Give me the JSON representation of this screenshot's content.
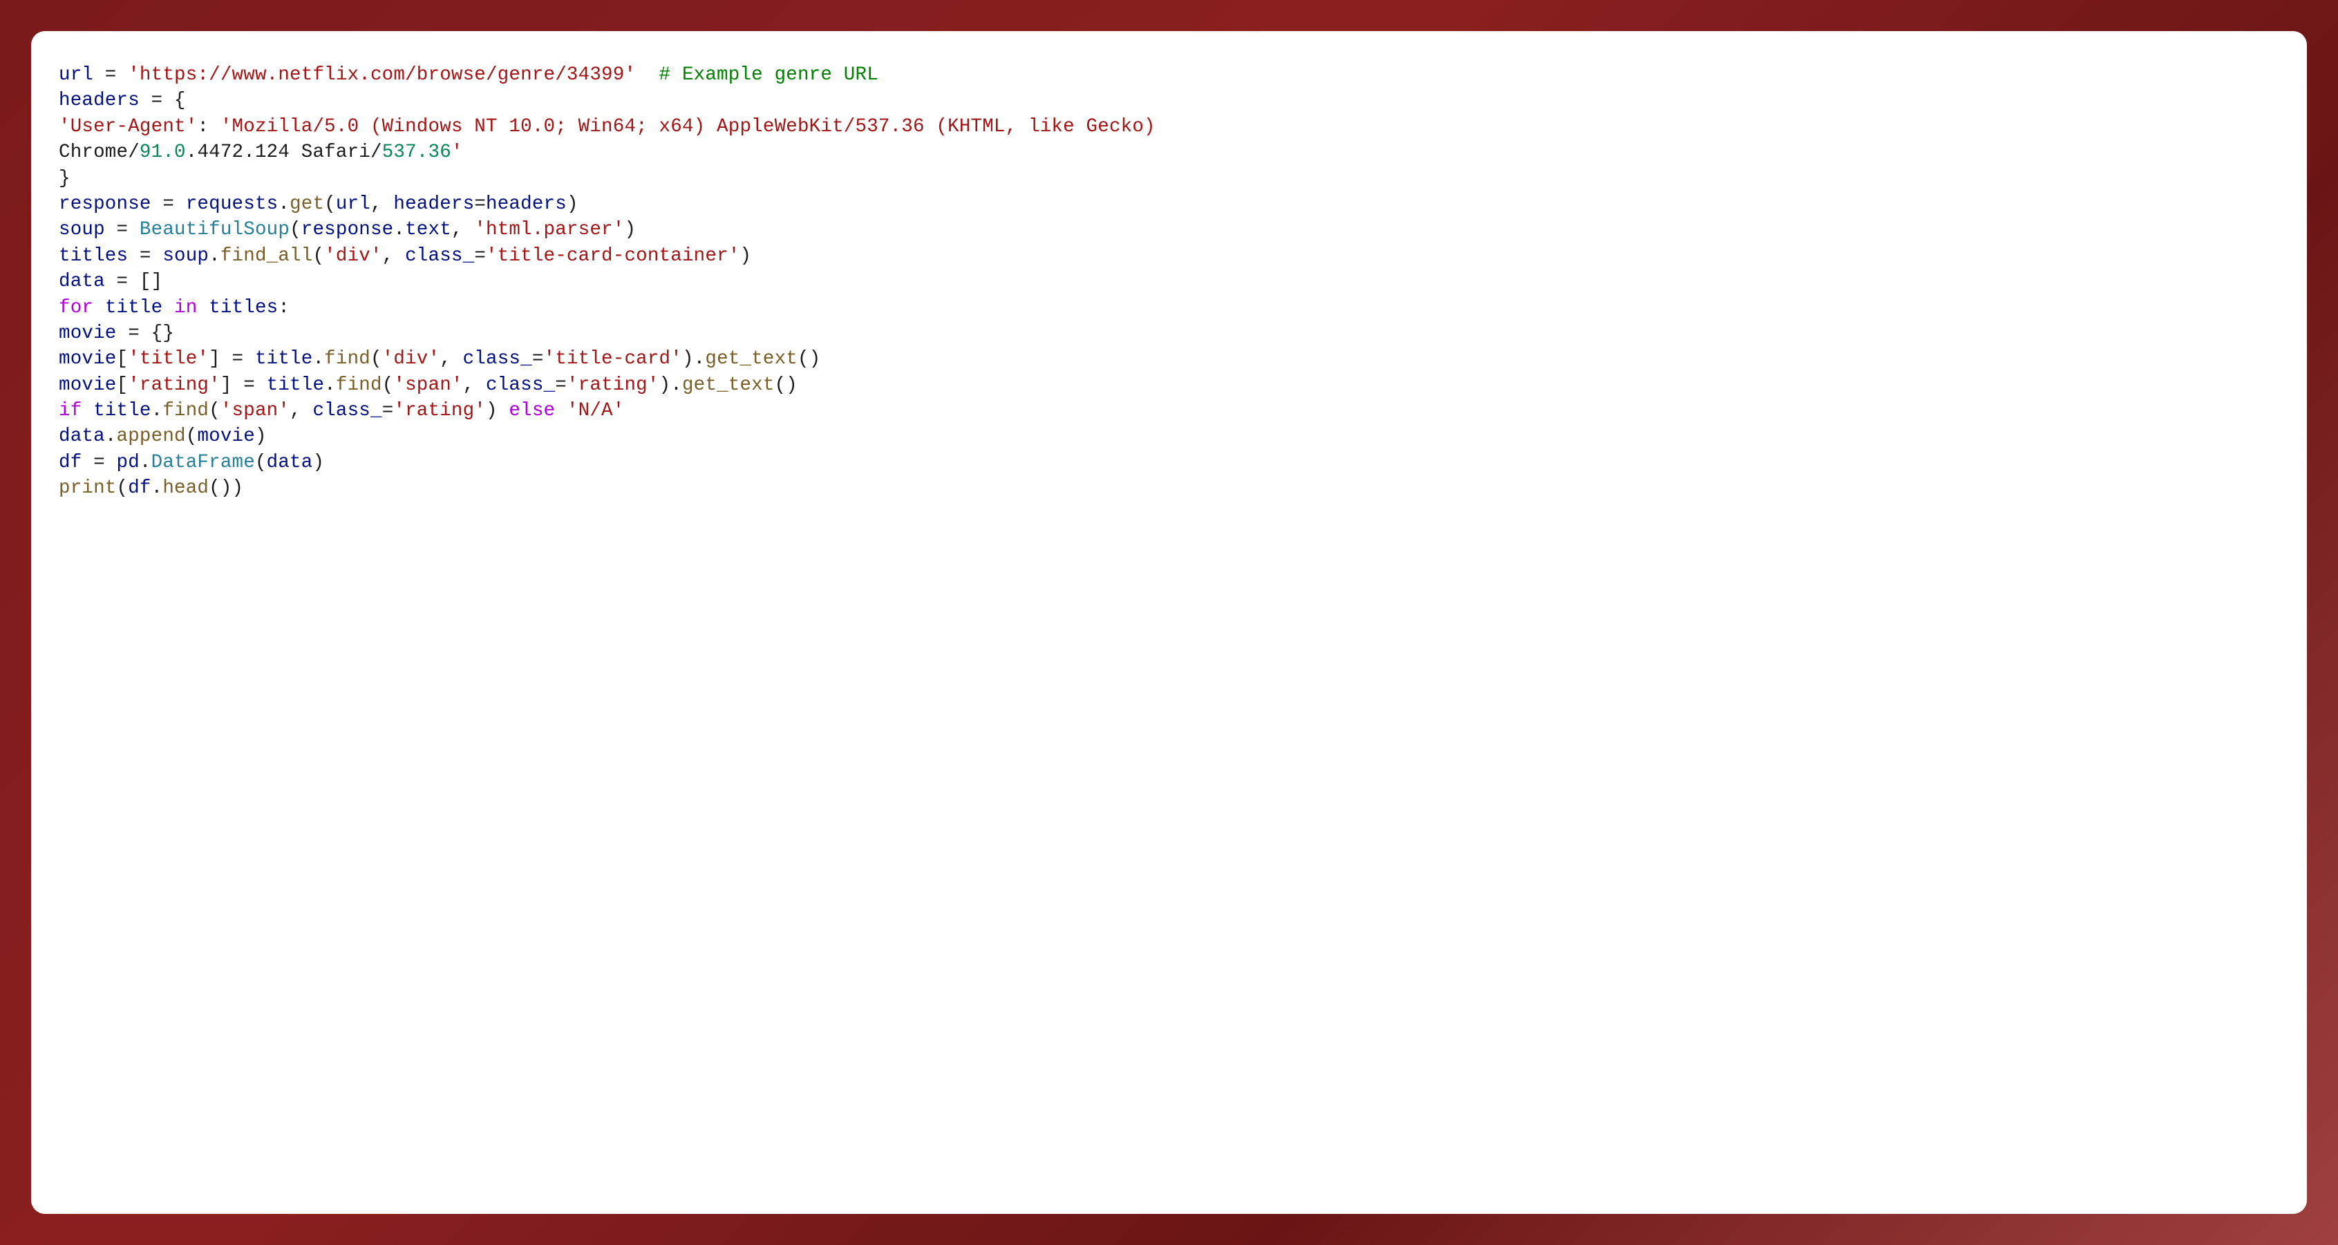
{
  "code": {
    "lines": [
      {
        "tokens": [
          {
            "text": "url",
            "class": "token-variable"
          },
          {
            "text": " = ",
            "class": "token-operator"
          },
          {
            "text": "'https://www.netflix.com/browse/genre/34399'",
            "class": "token-string"
          },
          {
            "text": "  ",
            "class": ""
          },
          {
            "text": "# Example genre URL",
            "class": "token-comment"
          }
        ]
      },
      {
        "tokens": [
          {
            "text": "headers",
            "class": "token-variable"
          },
          {
            "text": " = {",
            "class": "token-operator"
          }
        ]
      },
      {
        "tokens": [
          {
            "text": "'User-Agent'",
            "class": "token-string"
          },
          {
            "text": ": ",
            "class": "token-punct"
          },
          {
            "text": "'Mozilla/5.0 (Windows NT 10.0; Win64; x64) AppleWebKit/537.36 (KHTML, like Gecko) ",
            "class": "token-string"
          }
        ]
      },
      {
        "tokens": [
          {
            "text": "Chrome/",
            "class": ""
          },
          {
            "text": "91.0",
            "class": "token-number"
          },
          {
            "text": ".",
            "class": ""
          },
          {
            "text": "4472.124",
            "class": ""
          },
          {
            "text": " Safari/",
            "class": ""
          },
          {
            "text": "537.36",
            "class": "token-number"
          },
          {
            "text": "'",
            "class": "token-string"
          }
        ]
      },
      {
        "tokens": [
          {
            "text": "}",
            "class": "token-punct"
          }
        ]
      },
      {
        "tokens": [
          {
            "text": "response",
            "class": "token-variable"
          },
          {
            "text": " = ",
            "class": "token-operator"
          },
          {
            "text": "requests",
            "class": "token-variable"
          },
          {
            "text": ".",
            "class": "token-punct"
          },
          {
            "text": "get",
            "class": "token-function"
          },
          {
            "text": "(",
            "class": "token-punct"
          },
          {
            "text": "url",
            "class": "token-variable"
          },
          {
            "text": ", ",
            "class": "token-punct"
          },
          {
            "text": "headers",
            "class": "token-variable"
          },
          {
            "text": "=",
            "class": "token-operator"
          },
          {
            "text": "headers",
            "class": "token-variable"
          },
          {
            "text": ")",
            "class": "token-punct"
          }
        ]
      },
      {
        "tokens": [
          {
            "text": "soup",
            "class": "token-variable"
          },
          {
            "text": " = ",
            "class": "token-operator"
          },
          {
            "text": "BeautifulSoup",
            "class": "token-classname"
          },
          {
            "text": "(",
            "class": "token-punct"
          },
          {
            "text": "response",
            "class": "token-variable"
          },
          {
            "text": ".",
            "class": "token-punct"
          },
          {
            "text": "text",
            "class": "token-property"
          },
          {
            "text": ", ",
            "class": "token-punct"
          },
          {
            "text": "'html.parser'",
            "class": "token-string"
          },
          {
            "text": ")",
            "class": "token-punct"
          }
        ]
      },
      {
        "tokens": [
          {
            "text": "titles",
            "class": "token-variable"
          },
          {
            "text": " = ",
            "class": "token-operator"
          },
          {
            "text": "soup",
            "class": "token-variable"
          },
          {
            "text": ".",
            "class": "token-punct"
          },
          {
            "text": "find_all",
            "class": "token-function"
          },
          {
            "text": "(",
            "class": "token-punct"
          },
          {
            "text": "'div'",
            "class": "token-string"
          },
          {
            "text": ", ",
            "class": "token-punct"
          },
          {
            "text": "class_",
            "class": "token-variable"
          },
          {
            "text": "=",
            "class": "token-operator"
          },
          {
            "text": "'title-card-container'",
            "class": "token-string"
          },
          {
            "text": ")",
            "class": "token-punct"
          }
        ]
      },
      {
        "tokens": [
          {
            "text": "data",
            "class": "token-variable"
          },
          {
            "text": " = []",
            "class": "token-operator"
          }
        ]
      },
      {
        "tokens": [
          {
            "text": "for",
            "class": "token-keyword-purple"
          },
          {
            "text": " ",
            "class": ""
          },
          {
            "text": "title",
            "class": "token-variable"
          },
          {
            "text": " ",
            "class": ""
          },
          {
            "text": "in",
            "class": "token-keyword-purple"
          },
          {
            "text": " ",
            "class": ""
          },
          {
            "text": "titles",
            "class": "token-variable"
          },
          {
            "text": ":",
            "class": "token-punct"
          }
        ]
      },
      {
        "tokens": [
          {
            "text": "movie",
            "class": "token-variable"
          },
          {
            "text": " = {}",
            "class": "token-operator"
          }
        ]
      },
      {
        "tokens": [
          {
            "text": "movie",
            "class": "token-variable"
          },
          {
            "text": "[",
            "class": "token-punct"
          },
          {
            "text": "'title'",
            "class": "token-string"
          },
          {
            "text": "] = ",
            "class": "token-operator"
          },
          {
            "text": "title",
            "class": "token-variable"
          },
          {
            "text": ".",
            "class": "token-punct"
          },
          {
            "text": "find",
            "class": "token-function"
          },
          {
            "text": "(",
            "class": "token-punct"
          },
          {
            "text": "'div'",
            "class": "token-string"
          },
          {
            "text": ", ",
            "class": "token-punct"
          },
          {
            "text": "class_",
            "class": "token-variable"
          },
          {
            "text": "=",
            "class": "token-operator"
          },
          {
            "text": "'title-card'",
            "class": "token-string"
          },
          {
            "text": ").",
            "class": "token-punct"
          },
          {
            "text": "get_text",
            "class": "token-function"
          },
          {
            "text": "()",
            "class": "token-punct"
          }
        ]
      },
      {
        "tokens": [
          {
            "text": "movie",
            "class": "token-variable"
          },
          {
            "text": "[",
            "class": "token-punct"
          },
          {
            "text": "'rating'",
            "class": "token-string"
          },
          {
            "text": "] = ",
            "class": "token-operator"
          },
          {
            "text": "title",
            "class": "token-variable"
          },
          {
            "text": ".",
            "class": "token-punct"
          },
          {
            "text": "find",
            "class": "token-function"
          },
          {
            "text": "(",
            "class": "token-punct"
          },
          {
            "text": "'span'",
            "class": "token-string"
          },
          {
            "text": ", ",
            "class": "token-punct"
          },
          {
            "text": "class_",
            "class": "token-variable"
          },
          {
            "text": "=",
            "class": "token-operator"
          },
          {
            "text": "'rating'",
            "class": "token-string"
          },
          {
            "text": ").",
            "class": "token-punct"
          },
          {
            "text": "get_text",
            "class": "token-function"
          },
          {
            "text": "()",
            "class": "token-punct"
          }
        ]
      },
      {
        "tokens": [
          {
            "text": "if",
            "class": "token-keyword-purple"
          },
          {
            "text": " ",
            "class": ""
          },
          {
            "text": "title",
            "class": "token-variable"
          },
          {
            "text": ".",
            "class": "token-punct"
          },
          {
            "text": "find",
            "class": "token-function"
          },
          {
            "text": "(",
            "class": "token-punct"
          },
          {
            "text": "'span'",
            "class": "token-string"
          },
          {
            "text": ", ",
            "class": "token-punct"
          },
          {
            "text": "class_",
            "class": "token-variable"
          },
          {
            "text": "=",
            "class": "token-operator"
          },
          {
            "text": "'rating'",
            "class": "token-string"
          },
          {
            "text": ") ",
            "class": "token-punct"
          },
          {
            "text": "else",
            "class": "token-keyword-purple"
          },
          {
            "text": " ",
            "class": ""
          },
          {
            "text": "'N/A'",
            "class": "token-string"
          }
        ]
      },
      {
        "tokens": [
          {
            "text": "data",
            "class": "token-variable"
          },
          {
            "text": ".",
            "class": "token-punct"
          },
          {
            "text": "append",
            "class": "token-function"
          },
          {
            "text": "(",
            "class": "token-punct"
          },
          {
            "text": "movie",
            "class": "token-variable"
          },
          {
            "text": ")",
            "class": "token-punct"
          }
        ]
      },
      {
        "tokens": [
          {
            "text": "df",
            "class": "token-variable"
          },
          {
            "text": " = ",
            "class": "token-operator"
          },
          {
            "text": "pd",
            "class": "token-variable"
          },
          {
            "text": ".",
            "class": "token-punct"
          },
          {
            "text": "DataFrame",
            "class": "token-classname"
          },
          {
            "text": "(",
            "class": "token-punct"
          },
          {
            "text": "data",
            "class": "token-variable"
          },
          {
            "text": ")",
            "class": "token-punct"
          }
        ]
      },
      {
        "tokens": [
          {
            "text": "print",
            "class": "token-function"
          },
          {
            "text": "(",
            "class": "token-punct"
          },
          {
            "text": "df",
            "class": "token-variable"
          },
          {
            "text": ".",
            "class": "token-punct"
          },
          {
            "text": "head",
            "class": "token-function"
          },
          {
            "text": "())",
            "class": "token-punct"
          }
        ]
      }
    ]
  }
}
